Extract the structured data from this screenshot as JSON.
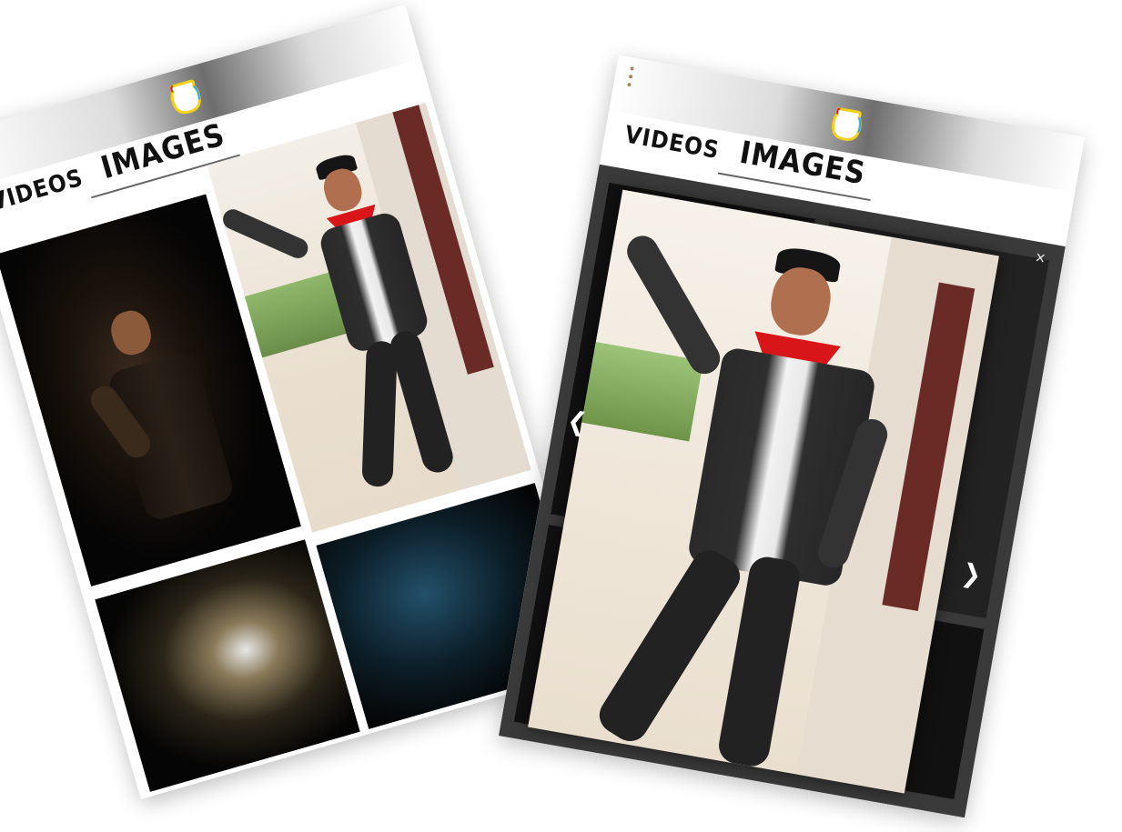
{
  "screens": [
    {
      "tabs": {
        "videos": "VIDEOS",
        "images": "IMAGES"
      },
      "menu_icon": "dots-vertical-icon",
      "logo_icon": "jar-logo-icon",
      "active_tab": "IMAGES",
      "gallery": [
        "dark-portrait-thumb",
        "dancer-thumb",
        "fireworks-thumb",
        "blue-scene-thumb"
      ]
    },
    {
      "tabs": {
        "videos": "VIDEOS",
        "images": "IMAGES"
      },
      "menu_icon": "dots-vertical-icon",
      "logo_icon": "jar-logo-icon",
      "active_tab": "IMAGES",
      "viewer": {
        "close": "×",
        "prev": "❮",
        "next": "❯"
      }
    }
  ]
}
